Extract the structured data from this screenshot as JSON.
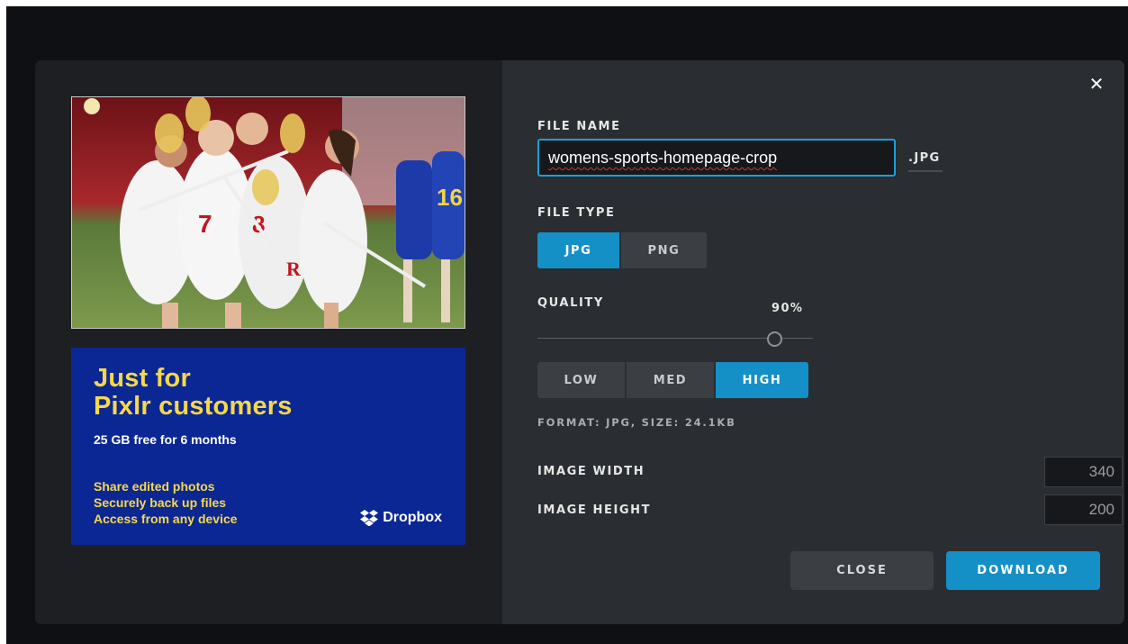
{
  "preview": {
    "alt": "Lacrosse players celebrating on field"
  },
  "ad": {
    "headline_line1": "Just for",
    "headline_line2": "Pixlr customers",
    "subtext": "25 GB free for 6 months",
    "bullets": [
      "Share edited photos",
      "Securely back up files",
      "Access from any device"
    ],
    "brand": "Dropbox",
    "brand_icon": "dropbox-icon",
    "headline_color": "#f7d84a",
    "background_color": "#0b2794"
  },
  "dialog": {
    "close_icon": "close-icon",
    "file_name_label": "FILE NAME",
    "file_name_value": "womens-sports-homepage-crop",
    "file_extension": ".JPG",
    "file_type_label": "FILE TYPE",
    "file_types": [
      "JPG",
      "PNG"
    ],
    "file_type_selected": "JPG",
    "quality_label": "QUALITY",
    "quality_value": "90%",
    "quality_fraction": 0.9,
    "quality_presets": [
      "LOW",
      "MED",
      "HIGH"
    ],
    "quality_preset_selected": "HIGH",
    "format_info": "FORMAT: JPG, SIZE: 24.1KB",
    "width_label": "IMAGE WIDTH",
    "width_value": "340",
    "height_label": "IMAGE HEIGHT",
    "height_value": "200",
    "close_button": "CLOSE",
    "download_button": "DOWNLOAD",
    "accent_color": "#1590c6"
  }
}
